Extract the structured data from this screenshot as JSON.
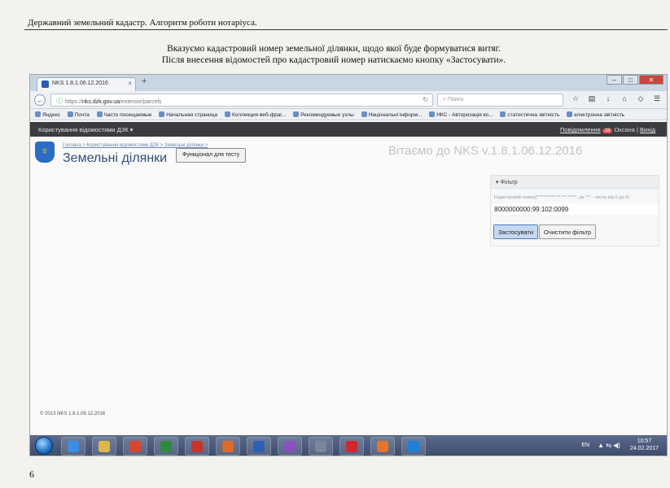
{
  "document": {
    "header": "Державний земельний кадастр. Алгоритм роботи нотаріуса.",
    "intro_line1": "Вказуємо кадастровий номер земельної ділянки, щодо якої буде формуватися витяг.",
    "intro_line2": "Після внесення відомостей про кадастровий номер натискаємо кнопку «Застосувати».",
    "page_number": "6"
  },
  "browser": {
    "tab_title": "NKS 1.8.1.06.12.2016",
    "tab_close": "×",
    "new_tab": "+",
    "url_prefix": "https://",
    "url_domain": "nks.dzk.gov.ua",
    "url_path": "/extenior/parcels",
    "search_placeholder": "Поиск",
    "bookmarks": [
      "Яндекс",
      "Почта",
      "Часто посещаемые",
      "Начальная страница",
      "Коллекция веб-фраг...",
      "Рекомендуемые узлы",
      "Національні інформ...",
      "НКС - Авторизація ко...",
      "статистична звітність",
      "електронна звітність"
    ]
  },
  "app": {
    "menu_label": "Користування відомостями ДЗК ▾",
    "notifications_label": "Повідомлення",
    "notifications_count": "28",
    "user_name": "Оксана",
    "separator": "|",
    "logout_label": "Вихід",
    "ghost_title": "Вітаємо до NKS v.1.8.1.06.12.2016",
    "breadcrumb": "Головна > Користування відомостями ДЗК > Земельні ділянки >",
    "page_title": "Земельні ділянки",
    "test_button": "Функціонал для тесту",
    "filter": {
      "heading": "▾ Фільтр",
      "label": "Кадастровий номер(\"**********:**:***:****\", де \"*\" - числа від 0 до 9)",
      "value": "8000000000:99:102:0099",
      "apply_button": "Застосувати",
      "clear_button": "Очистити фільтр"
    },
    "footer": "© 2013 NKS 1.8.1.06.12.2016"
  },
  "taskbar": {
    "language": "EN",
    "tray_icons": "▲ ⇆ ◀)",
    "time": "10:57",
    "date": "24.02.2017",
    "app_colors": [
      "#3a8ee6",
      "#e0b64a",
      "#d9462f",
      "#2e8b3d",
      "#c8332b",
      "#e06a2a",
      "#2d5fb3",
      "#8a4fc0",
      "#7a8799",
      "#d2262b",
      "#e8742a",
      "#1d7fd6"
    ]
  }
}
